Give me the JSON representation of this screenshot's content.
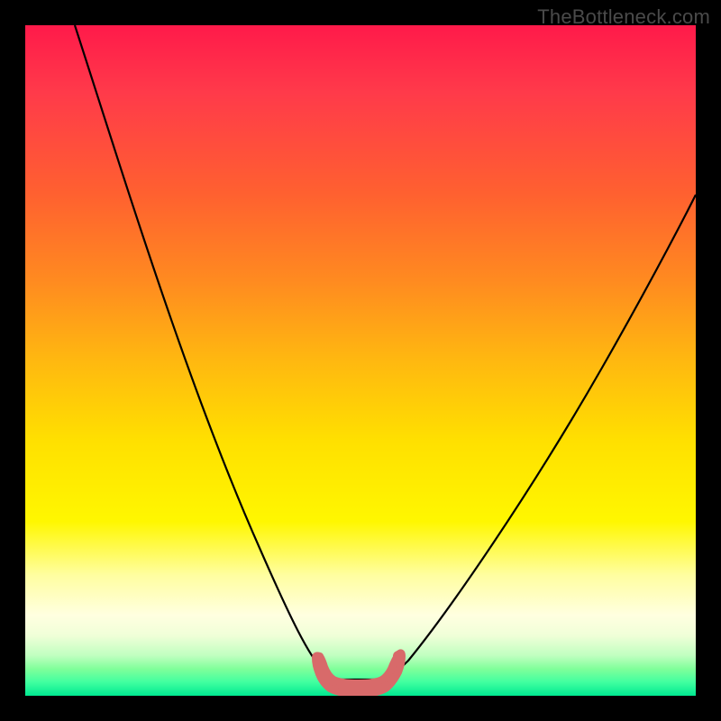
{
  "watermark": {
    "text": "TheBottleneck.com"
  },
  "chart_data": {
    "type": "line",
    "title": "",
    "xlabel": "",
    "ylabel": "",
    "xlim": [
      0,
      100
    ],
    "ylim": [
      0,
      100
    ],
    "background_gradient": {
      "top_color": "#ff1a4a",
      "bottom_color": "#00e890",
      "meaning": "high (bottleneck) to low (optimal)"
    },
    "series": [
      {
        "name": "bottleneck-curve",
        "x": [
          0,
          5,
          10,
          15,
          20,
          25,
          30,
          35,
          40,
          42,
          44,
          46,
          48,
          50,
          52,
          55,
          60,
          65,
          70,
          75,
          80,
          85,
          90,
          95,
          100
        ],
        "y": [
          100,
          90,
          79,
          68,
          57,
          45,
          33,
          21,
          10,
          6,
          3,
          1,
          0,
          0,
          0,
          2,
          8,
          15,
          23,
          31,
          40,
          49,
          58,
          66,
          72
        ]
      }
    ],
    "annotations": [
      {
        "name": "optimal-zone-marker",
        "type": "highlighted-segment",
        "x_range": [
          42,
          55
        ],
        "y_range": [
          0,
          3
        ],
        "color": "#d86a6a"
      }
    ]
  }
}
